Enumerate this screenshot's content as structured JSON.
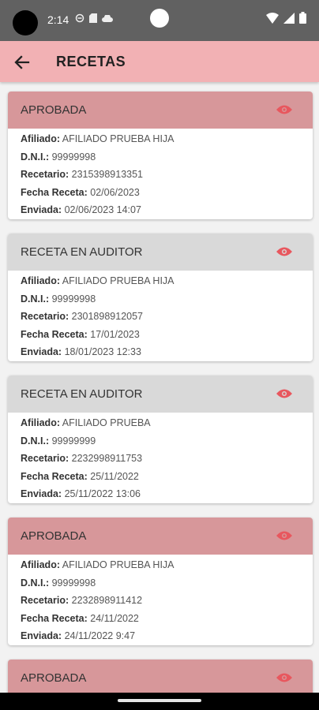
{
  "status_bar": {
    "time": "2:14",
    "icons": [
      "camera-dot",
      "sync-icon",
      "sd-card-icon",
      "cloud-icon",
      "wifi-icon",
      "signal-icon",
      "battery-icon"
    ]
  },
  "appbar": {
    "title": "RECETAS",
    "back_icon": "arrow-back-icon"
  },
  "colors": {
    "appbar": "#f2b1b4",
    "approved_header": "#d7979a",
    "auditor_header": "#d9d9d9",
    "eye_icon": "#e8575e"
  },
  "labels": {
    "afiliado": "Afiliado:",
    "dni": "D.N.I.:",
    "recetario": "Recetario:",
    "fecha": "Fecha Receta:",
    "enviada": "Enviada:"
  },
  "cards": [
    {
      "status": "APROBADA",
      "afiliado": "AFILIADO PRUEBA HIJA",
      "dni": "99999998",
      "recetario": "2315398913351",
      "fecha": "02/06/2023",
      "enviada": "02/06/2023 14:07"
    },
    {
      "status": "RECETA EN AUDITOR",
      "afiliado": "AFILIADO PRUEBA HIJA",
      "dni": "99999998",
      "recetario": "2301898912057",
      "fecha": "17/01/2023",
      "enviada": "18/01/2023 12:33"
    },
    {
      "status": "RECETA EN AUDITOR",
      "afiliado": "AFILIADO PRUEBA",
      "dni": "99999999",
      "recetario": "2232998911753",
      "fecha": "25/11/2022",
      "enviada": "25/11/2022 13:06"
    },
    {
      "status": "APROBADA",
      "afiliado": "AFILIADO PRUEBA HIJA",
      "dni": "99999998",
      "recetario": "2232898911412",
      "fecha": "24/11/2022",
      "enviada": "24/11/2022 9:47"
    },
    {
      "status": "APROBADA"
    }
  ]
}
